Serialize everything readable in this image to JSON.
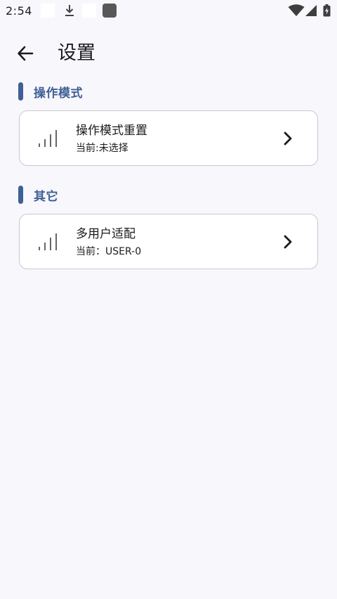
{
  "status_bar": {
    "time": "2:54",
    "icons": [
      "notification-placeholder",
      "download-icon",
      "notification-placeholder",
      "app-icon",
      "wifi-icon",
      "cellular-signal-icon",
      "battery-icon"
    ]
  },
  "header": {
    "title": "设置",
    "back_icon": "arrow-left-icon"
  },
  "sections": [
    {
      "title": "操作模式",
      "items": [
        {
          "title": "操作模式重置",
          "subtitle": "当前:未选择",
          "icon": "signal-bars-icon",
          "action_icon": "chevron-right-icon"
        }
      ]
    },
    {
      "title": "其它",
      "items": [
        {
          "title": "多用户适配",
          "subtitle": "当前：USER-0",
          "icon": "signal-bars-icon",
          "action_icon": "chevron-right-icon"
        }
      ]
    }
  ],
  "colors": {
    "background": "#f8f7fc",
    "accent": "#3f5f95",
    "card": "#ffffff",
    "card_border": "#c9c8d0",
    "text": "#1b1b1f"
  }
}
